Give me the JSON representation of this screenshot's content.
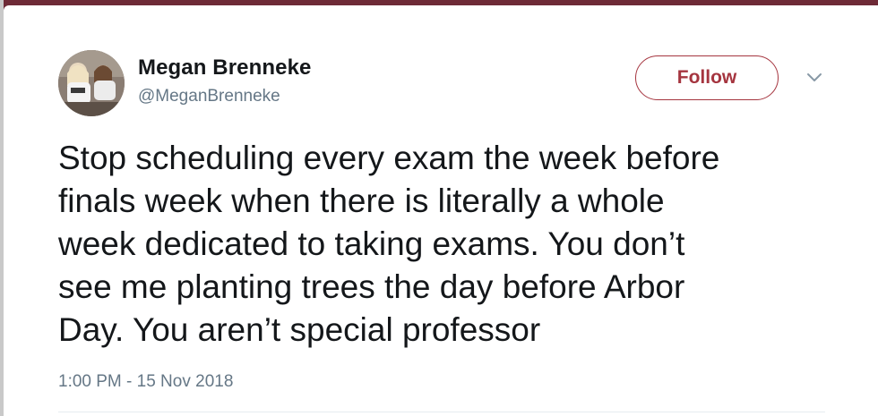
{
  "user": {
    "display_name": "Megan Brenneke",
    "handle": "@MeganBrenneke"
  },
  "actions": {
    "follow_label": "Follow",
    "more_icon": "chevron-down-icon"
  },
  "tweet": {
    "text": "Stop scheduling every exam the week before\nfinals week when there is literally a whole\nweek dedicated to taking exams. You don’t\nsee me planting trees the day before Arbor\nDay. You aren’t special professor",
    "timestamp": "1:00 PM - 15 Nov 2018"
  },
  "colors": {
    "accent": "#a5353f",
    "background_frame": "#6e2a37",
    "secondary_text": "#657786",
    "primary_text": "#14171a"
  }
}
